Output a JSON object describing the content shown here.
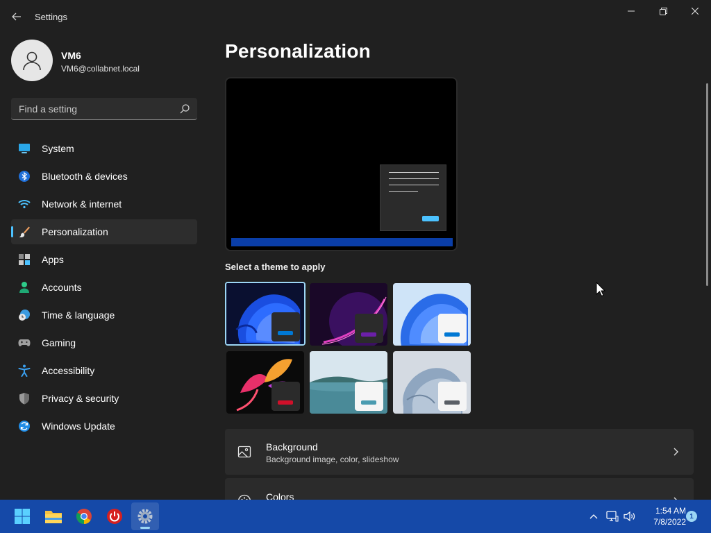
{
  "window": {
    "title": "Settings",
    "back_icon": "back-arrow-icon",
    "controls": [
      "minimize-icon",
      "maximize-icon",
      "close-icon"
    ]
  },
  "profile": {
    "name": "VM6",
    "email": "VM6@collabnet.local"
  },
  "search": {
    "placeholder": "Find a setting",
    "icon": "search-icon"
  },
  "sidebar": {
    "items": [
      {
        "label": "System",
        "icon": "system-icon",
        "selected": false
      },
      {
        "label": "Bluetooth & devices",
        "icon": "bluetooth-icon",
        "selected": false
      },
      {
        "label": "Network & internet",
        "icon": "wifi-icon",
        "selected": false
      },
      {
        "label": "Personalization",
        "icon": "paintbrush-icon",
        "selected": true
      },
      {
        "label": "Apps",
        "icon": "apps-icon",
        "selected": false
      },
      {
        "label": "Accounts",
        "icon": "person-icon",
        "selected": false
      },
      {
        "label": "Time & language",
        "icon": "clock-globe-icon",
        "selected": false
      },
      {
        "label": "Gaming",
        "icon": "gamepad-icon",
        "selected": false
      },
      {
        "label": "Accessibility",
        "icon": "accessibility-icon",
        "selected": false
      },
      {
        "label": "Privacy & security",
        "icon": "shield-icon",
        "selected": false
      },
      {
        "label": "Windows Update",
        "icon": "update-icon",
        "selected": false
      }
    ]
  },
  "main": {
    "title": "Personalization",
    "theme_section_label": "Select a theme to apply",
    "themes": [
      {
        "name": "windows-dark-bloom",
        "selected": true,
        "accent": "#0078d4"
      },
      {
        "name": "glow",
        "selected": false,
        "accent": "#6b1fa8"
      },
      {
        "name": "windows-light-bloom",
        "selected": false,
        "accent": "#0078d4"
      },
      {
        "name": "captured-motion",
        "selected": false,
        "accent": "#d0102a"
      },
      {
        "name": "sunrise",
        "selected": false,
        "accent": "#4a9bb0"
      },
      {
        "name": "flow",
        "selected": false,
        "accent": "#5a5f66"
      }
    ],
    "cards": [
      {
        "title": "Background",
        "subtitle": "Background image, color, slideshow",
        "icon": "image-icon"
      },
      {
        "title": "Colors",
        "subtitle": "",
        "icon": "palette-icon"
      }
    ]
  },
  "taskbar": {
    "apps": [
      "start-icon",
      "file-explorer-icon",
      "chrome-icon",
      "power-app-icon",
      "settings-icon"
    ],
    "tray_icons": [
      "chevron-up-icon",
      "network-icon",
      "volume-icon"
    ],
    "time": "1:54 AM",
    "date": "7/8/2022",
    "notification_count": "1"
  },
  "colors": {
    "background": "#202020",
    "accent": "#4cc2ff",
    "taskbar": "#1549a8",
    "card": "#2b2b2b"
  }
}
